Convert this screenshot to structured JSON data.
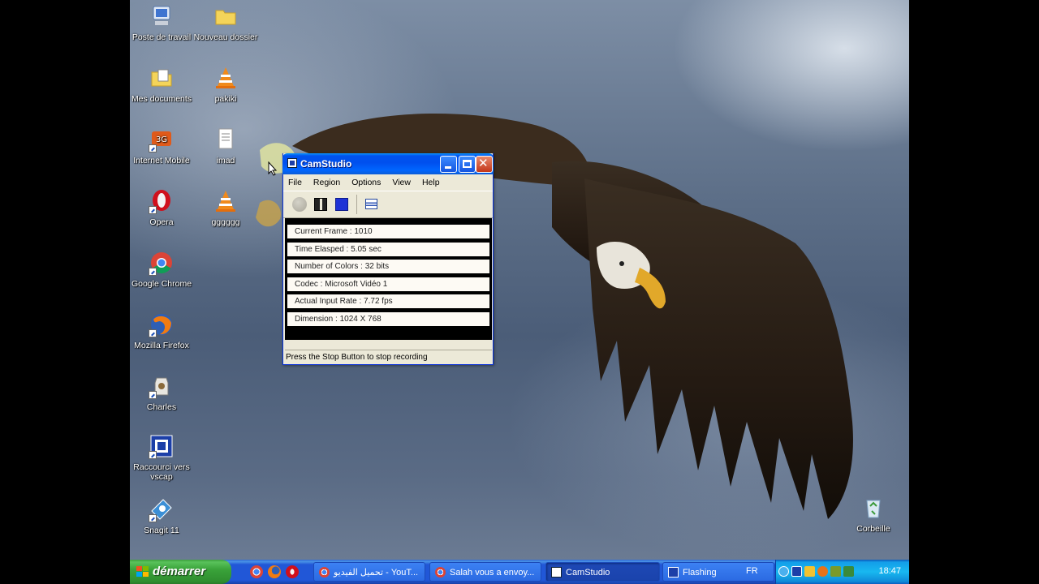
{
  "desktop": {
    "icons": [
      {
        "label": "Poste de travail",
        "icon": "computer-icon"
      },
      {
        "label": "Nouveau dossier",
        "icon": "folder-icon"
      },
      {
        "label": "Mes documents",
        "icon": "documents-folder-icon"
      },
      {
        "label": "pakiki",
        "icon": "vlc-icon"
      },
      {
        "label": "Internet Mobile",
        "icon": "internet-mobile-icon"
      },
      {
        "label": "imad",
        "icon": "text-file-icon"
      },
      {
        "label": "Opera",
        "icon": "opera-icon"
      },
      {
        "label": "gggggg",
        "icon": "vlc-icon"
      },
      {
        "label": "Google Chrome",
        "icon": "chrome-icon"
      },
      {
        "label": "Mozilla Firefox",
        "icon": "firefox-icon"
      },
      {
        "label": "Charles",
        "icon": "charles-icon"
      },
      {
        "label": "Raccourci vers vscap",
        "icon": "vscap-icon"
      },
      {
        "label": "Snagit 11",
        "icon": "snagit-icon"
      },
      {
        "label": "Corbeille",
        "icon": "recycle-bin-icon"
      }
    ]
  },
  "camstudio": {
    "title": "CamStudio",
    "menu": [
      "File",
      "Region",
      "Options",
      "View",
      "Help"
    ],
    "toolbar": [
      "record-icon",
      "pause-icon",
      "stop-icon",
      "autopan-icon"
    ],
    "info": [
      "Current Frame : 1010",
      "Time Elasped  : 5.05 sec",
      "Number of Colors  : 32 bits",
      "Codec  : Microsoft Vidéo 1",
      "Actual Input Rate  : 7.72 fps",
      "Dimension  : 1024 X 768"
    ],
    "status": "Press the Stop Button to stop recording"
  },
  "taskbar": {
    "start_label": "démarrer",
    "quick_launch": [
      "chrome-icon",
      "firefox-icon",
      "opera-icon"
    ],
    "tasks": [
      {
        "label": "تحميل الفيديو - YouT...",
        "icon": "chrome-icon",
        "active": false
      },
      {
        "label": "Salah vous a envoy...",
        "icon": "chrome-icon",
        "active": false
      },
      {
        "label": "CamStudio",
        "icon": "camstudio-icon",
        "active": true
      },
      {
        "label": "Flashing",
        "icon": "vscap-icon",
        "active": false
      }
    ],
    "language": "FR",
    "clock": "18:47"
  },
  "colors": {
    "taskbar_blue": "#2157d7",
    "start_green": "#3aa33a",
    "title_blue": "#0053ee",
    "tray_blue": "#18b8f0"
  }
}
